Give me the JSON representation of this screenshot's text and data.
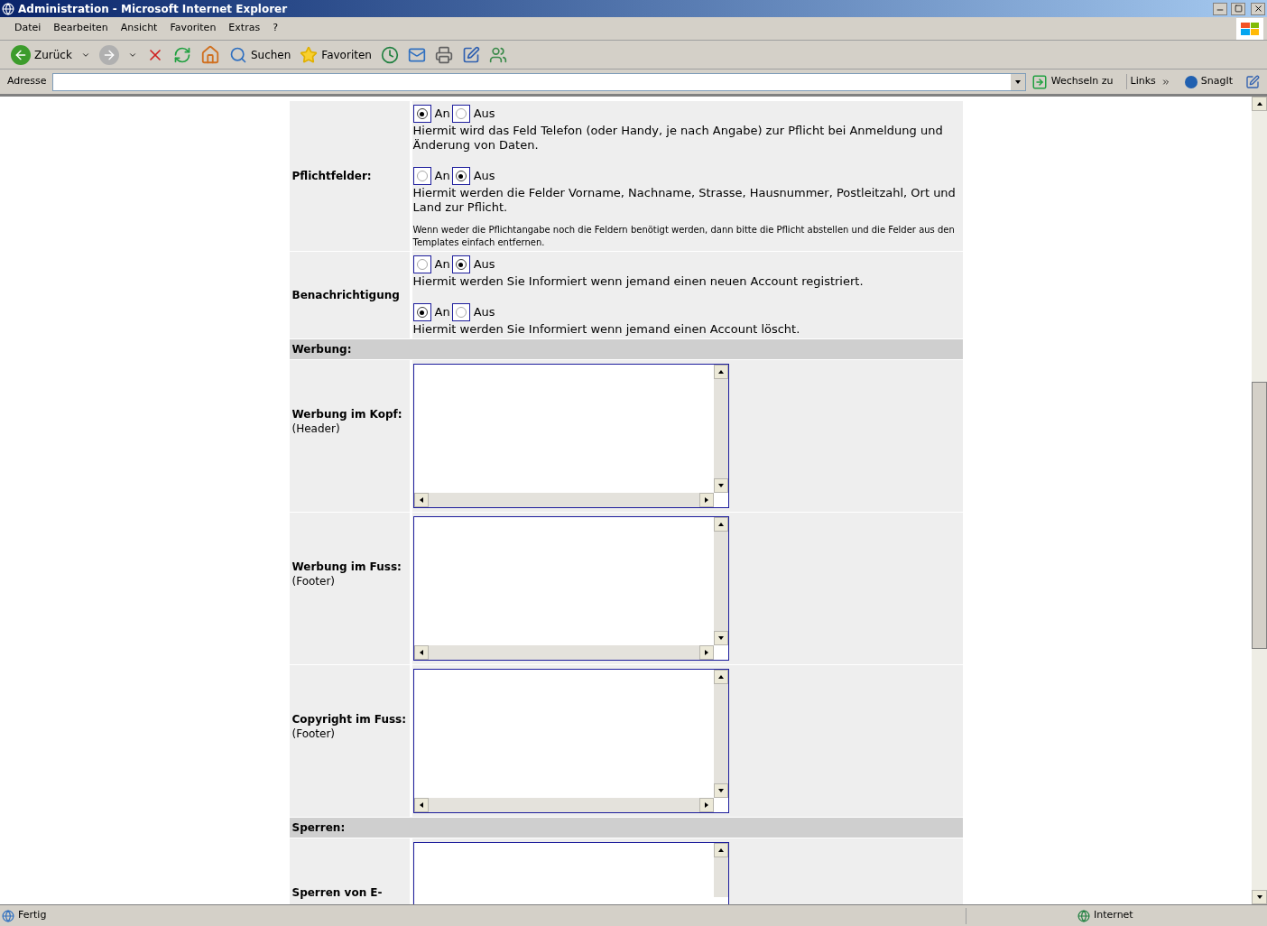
{
  "window": {
    "title": "Administration - Microsoft Internet Explorer"
  },
  "menu": [
    "Datei",
    "Bearbeiten",
    "Ansicht",
    "Favoriten",
    "Extras",
    "?"
  ],
  "toolbar": {
    "back": "Zurück",
    "search": "Suchen",
    "favorites": "Favoriten"
  },
  "address_bar": {
    "label": "Adresse",
    "go": "Wechseln zu",
    "links": "Links",
    "snagit": "SnagIt"
  },
  "rows": [
    {
      "kind": "radio",
      "label": "Pflichtfelder:",
      "groups": [
        {
          "options": [
            {
              "label": "An",
              "selected": true
            },
            {
              "label": "Aus",
              "selected": false
            }
          ],
          "description": "Hiermit wird das Feld Telefon (oder Handy, je nach Angabe) zur Pflicht bei Anmeldung und Änderung von Daten."
        },
        {
          "options": [
            {
              "label": "An",
              "selected": false
            },
            {
              "label": "Aus",
              "selected": true
            }
          ],
          "description": "Hiermit werden die Felder Vorname, Nachname, Strasse, Hausnummer, Postleitzahl, Ort und Land zur Pflicht."
        }
      ],
      "note": "Wenn weder die Pflichtangabe noch die Feldern benötigt werden, dann bitte die Pflicht abstellen und die Felder aus den Templates einfach entfernen."
    },
    {
      "kind": "radio",
      "label": "Benachrichtigung",
      "groups": [
        {
          "options": [
            {
              "label": "An",
              "selected": false
            },
            {
              "label": "Aus",
              "selected": true
            }
          ],
          "description": "Hiermit werden Sie Informiert wenn jemand einen neuen Account registriert."
        },
        {
          "options": [
            {
              "label": "An",
              "selected": true
            },
            {
              "label": "Aus",
              "selected": false
            }
          ],
          "description": "Hiermit werden Sie Informiert wenn jemand einen Account löscht."
        }
      ]
    },
    {
      "kind": "heading",
      "label": "Werbung:"
    },
    {
      "kind": "textarea",
      "label": "Werbung im Kopf:",
      "sub": "(Header)"
    },
    {
      "kind": "textarea",
      "label": "Werbung im Fuss:",
      "sub": "(Footer)"
    },
    {
      "kind": "textarea",
      "label": "Copyright im Fuss:",
      "sub": "(Footer)"
    },
    {
      "kind": "heading",
      "label": "Sperren:"
    },
    {
      "kind": "textarea",
      "label": "Sperren von E-"
    }
  ],
  "status_bar": {
    "text": "Fertig",
    "zone": "Internet"
  }
}
